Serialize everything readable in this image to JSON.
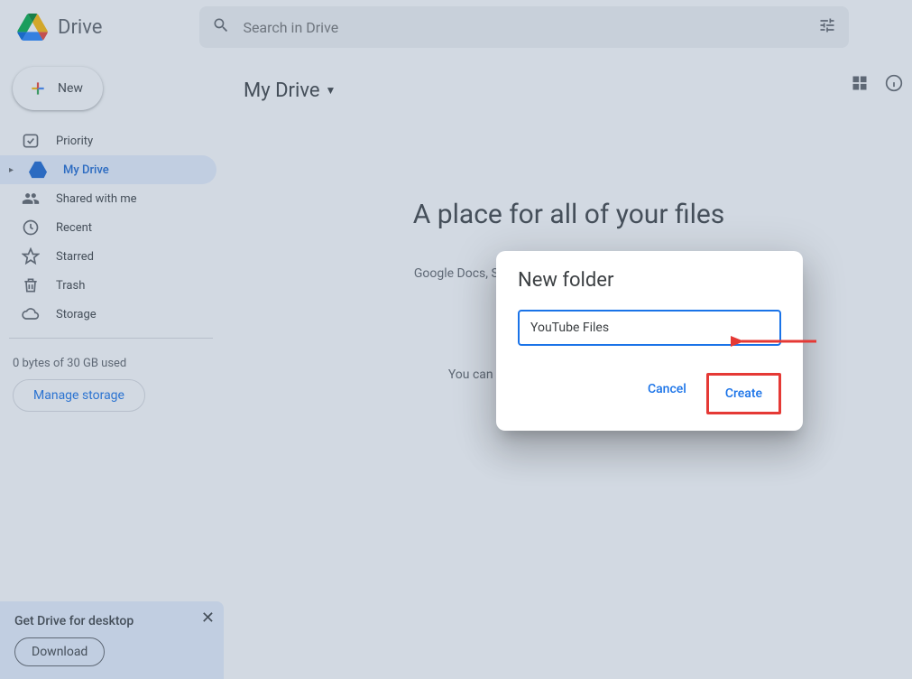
{
  "header": {
    "app_title": "Drive",
    "search_placeholder": "Search in Drive"
  },
  "new_button": {
    "label": "New"
  },
  "sidebar": {
    "items": [
      {
        "label": "Priority",
        "icon": "priority"
      },
      {
        "label": "My Drive",
        "icon": "drive",
        "active": true
      },
      {
        "label": "Shared with me",
        "icon": "shared"
      },
      {
        "label": "Recent",
        "icon": "recent"
      },
      {
        "label": "Starred",
        "icon": "starred"
      },
      {
        "label": "Trash",
        "icon": "trash"
      },
      {
        "label": "Storage",
        "icon": "storage"
      }
    ],
    "storage_text": "0 bytes of 30 GB used",
    "manage_label": "Manage storage"
  },
  "desktop_promo": {
    "title": "Get Drive for desktop",
    "download_label": "Download"
  },
  "breadcrumb": {
    "title": "My Drive"
  },
  "empty_state": {
    "title": "A place for all of your files",
    "subtitle": "Google Docs, Sheets, Slides, and more — plus hundreds",
    "drag_text": "You can drag files or folders right into Drive"
  },
  "modal": {
    "title": "New folder",
    "input_value": "YouTube Files",
    "cancel_label": "Cancel",
    "create_label": "Create"
  }
}
